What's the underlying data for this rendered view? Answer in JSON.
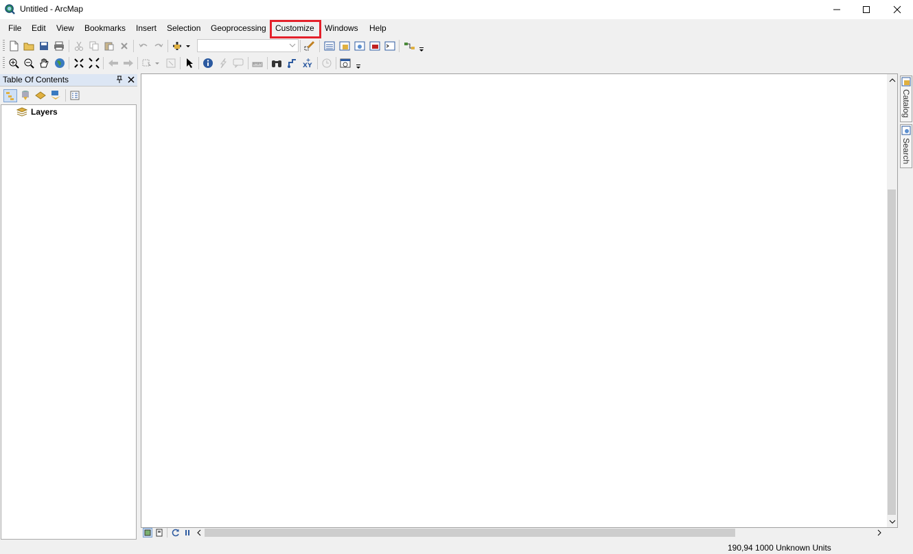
{
  "window": {
    "title": "Untitled - ArcMap",
    "app_icon": "arcmap-globe-icon",
    "controls": [
      "minimize-icon",
      "maximize-icon",
      "close-icon"
    ]
  },
  "menu": {
    "items": [
      "File",
      "Edit",
      "View",
      "Bookmarks",
      "Insert",
      "Selection",
      "Geoprocessing",
      "Customize",
      "Windows",
      "Help"
    ],
    "highlighted": "Customize",
    "highlight_color": "#e4202a"
  },
  "standard_toolbar": {
    "icons": [
      "new-document-icon",
      "open-folder-icon",
      "save-icon",
      "print-icon",
      "cut-icon",
      "copy-icon",
      "paste-icon",
      "delete-icon",
      "undo-icon",
      "redo-icon",
      "add-data-icon",
      "editor-icon",
      "table-of-contents-icon",
      "catalog-window-icon",
      "search-window-icon",
      "arctoolbox-icon",
      "python-icon",
      "model-builder-icon"
    ],
    "scale_value": ""
  },
  "tools_toolbar": {
    "icons": [
      "zoom-in-icon",
      "zoom-out-icon",
      "pan-icon",
      "full-extent-icon",
      "fixed-zoom-in-icon",
      "fixed-zoom-out-icon",
      "back-icon",
      "forward-icon",
      "select-features-icon",
      "clear-selection-icon",
      "select-elements-icon",
      "identify-icon",
      "hyperlink-icon",
      "html-popup-icon",
      "measure-icon",
      "find-icon",
      "find-route-icon",
      "go-to-xy-icon",
      "time-slider-icon",
      "create-viewer-window-icon"
    ]
  },
  "toc": {
    "title": "Table Of Contents",
    "tabs": [
      "list-by-drawing-order-icon",
      "list-by-source-icon",
      "list-by-visibility-icon",
      "list-by-selection-icon",
      "options-icon"
    ],
    "root_layer": "Layers"
  },
  "side_dock": {
    "tabs": [
      "Catalog",
      "Search"
    ]
  },
  "status": {
    "coordinates": "190,94",
    "units": "1000 Unknown Units"
  }
}
